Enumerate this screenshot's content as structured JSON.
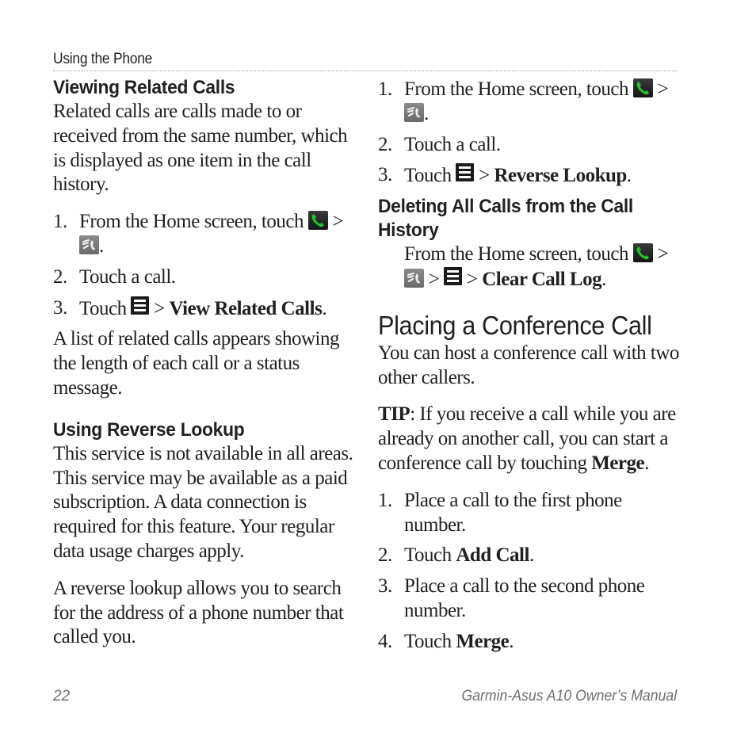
{
  "header": {
    "running_head": "Using the Phone"
  },
  "left": {
    "viewing": {
      "title": "Viewing Related Calls",
      "intro": "Related calls are calls made to or received from the same number, which is displayed as one item in the call history.",
      "steps": [
        {
          "num": "1.",
          "text": "From the Home screen, touch",
          "sep": ">",
          "end": "."
        },
        {
          "num": "2.",
          "text": "Touch a call."
        },
        {
          "num": "3.",
          "pre": "Touch",
          "sep": ">",
          "bold": "View Related Calls",
          "end": "."
        }
      ],
      "result": "A list of related calls appears showing the length of each call or a status message."
    },
    "reverse": {
      "title": "Using Reverse Lookup",
      "para1": "This service is not available in all areas. This service may be available as a paid subscription. A data connection is required for this feature. Your regular data usage charges apply.",
      "para2": "A reverse lookup allows you to search for the address of a phone number that called you."
    }
  },
  "right": {
    "reverse_steps": [
      {
        "num": "1.",
        "text": "From the Home screen, touch",
        "sep": ">",
        "end": "."
      },
      {
        "num": "2.",
        "text": "Touch a call."
      },
      {
        "num": "3.",
        "pre": "Touch",
        "sep": ">",
        "bold": "Reverse Lookup",
        "end": "."
      }
    ],
    "deleting": {
      "title_line1": "Deleting All Calls from the Call",
      "title_line2": "History",
      "text": "From the Home screen, touch",
      "sep1": ">",
      "sep2": ">",
      "sep3": ">",
      "bold": "Clear Call Log",
      "end": "."
    },
    "conference": {
      "title": "Placing a Conference Call",
      "intro": "You can host a conference call with two other callers.",
      "tip_label": "TIP",
      "tip_text": ": If you receive a call while you are already on another call, you can start a conference call by touching ",
      "tip_bold": "Merge",
      "tip_end": ".",
      "steps": [
        {
          "num": "1.",
          "text": "Place a call to the first phone number."
        },
        {
          "num": "2.",
          "pre": "Touch ",
          "bold": "Add Call",
          "end": "."
        },
        {
          "num": "3.",
          "text": "Place a call to the second phone number."
        },
        {
          "num": "4.",
          "pre": "Touch ",
          "bold": "Merge",
          "end": "."
        }
      ]
    }
  },
  "footer": {
    "page_number": "22",
    "manual_title": "Garmin-Asus A10 Owner’s Manual"
  },
  "icons": {
    "phone": "phone-icon",
    "history": "call-history-icon",
    "menu": "menu-icon"
  },
  "colors": {
    "phone_green": "#22c22a",
    "text": "#231f20",
    "footer_gray": "#6d6e71"
  }
}
